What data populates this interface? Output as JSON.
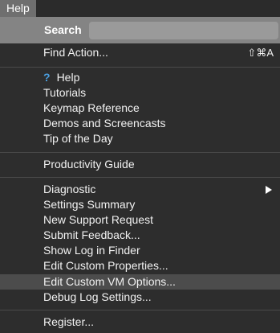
{
  "menubar": {
    "tab": "Help"
  },
  "menu": {
    "search_label": "Search",
    "search_placeholder": "",
    "find_action": {
      "label": "Find Action...",
      "shortcut": "⇧⌘A"
    },
    "help_icon": "?",
    "group1": [
      "Help",
      "Tutorials",
      "Keymap Reference",
      "Demos and Screencasts",
      "Tip of the Day"
    ],
    "productivity_guide": "Productivity Guide",
    "diagnostic": "Diagnostic",
    "group3": [
      "Settings Summary",
      "New Support Request",
      "Submit Feedback...",
      "Show Log in Finder",
      "Edit Custom Properties...",
      "Edit Custom VM Options...",
      "Debug Log Settings..."
    ],
    "register": "Register..."
  },
  "colors": {
    "accent": "#4b9fe0",
    "highlight": "#4c4c4c",
    "background": "#2d2d2d"
  }
}
